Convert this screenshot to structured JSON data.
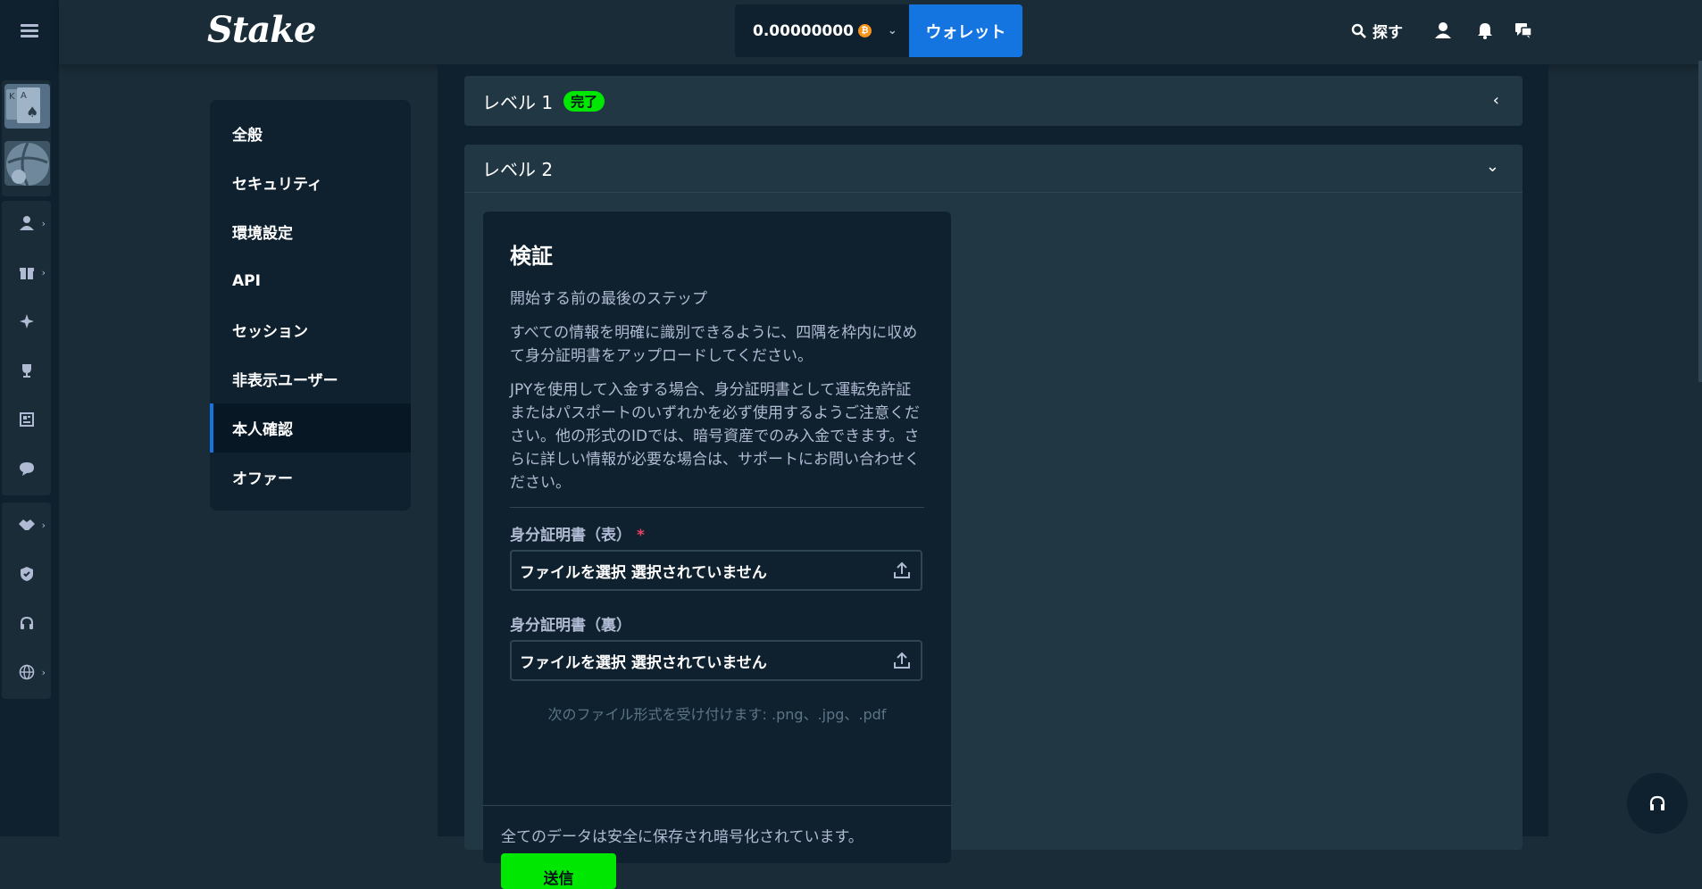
{
  "topbar": {
    "logo": "Stake",
    "balance": "0.00000000",
    "currency_symbol": "₿",
    "wallet_label": "ウォレット",
    "search_label": "探す"
  },
  "settings_nav": {
    "items": [
      {
        "label": "全般"
      },
      {
        "label": "セキュリティ"
      },
      {
        "label": "環境設定"
      },
      {
        "label": "API"
      },
      {
        "label": "セッション"
      },
      {
        "label": "非表示ユーザー"
      },
      {
        "label": "本人確認",
        "active": true
      },
      {
        "label": "オファー"
      }
    ]
  },
  "level1": {
    "title": "レベル 1",
    "badge": "完了"
  },
  "level2": {
    "title": "レベル 2"
  },
  "verification": {
    "title": "検証",
    "paragraph1": "開始する前の最後のステップ",
    "paragraph2": "すべての情報を明確に識別できるように、四隅を枠内に収めて身分証明書をアップロードしてください。",
    "paragraph3": "JPYを使用して入金する場合、身分証明書として運転免許証またはパスポートのいずれかを必ず使用するようご注意ください。他の形式のIDでは、暗号資産でのみ入金できます。さらに詳しい情報が必要な場合は、サポートにお問い合わせください。",
    "front_label": "身分証明書（表）",
    "required_mark": "*",
    "front_value": "ファイルを選択 選択されていません",
    "back_label": "身分証明書（裏）",
    "back_value": "ファイルを選択 選択されていません",
    "accepted_formats": "次のファイル形式を受け付けます: .png、.jpg、.pdf",
    "secure_note": "全てのデータは安全に保存され暗号化されています。",
    "submit_label": "送信"
  },
  "colors": {
    "accent_blue": "#1475e1",
    "success_green": "#00e701",
    "bg_dark": "#0f212e",
    "bg_mid": "#1a2c38",
    "panel": "#213743"
  }
}
